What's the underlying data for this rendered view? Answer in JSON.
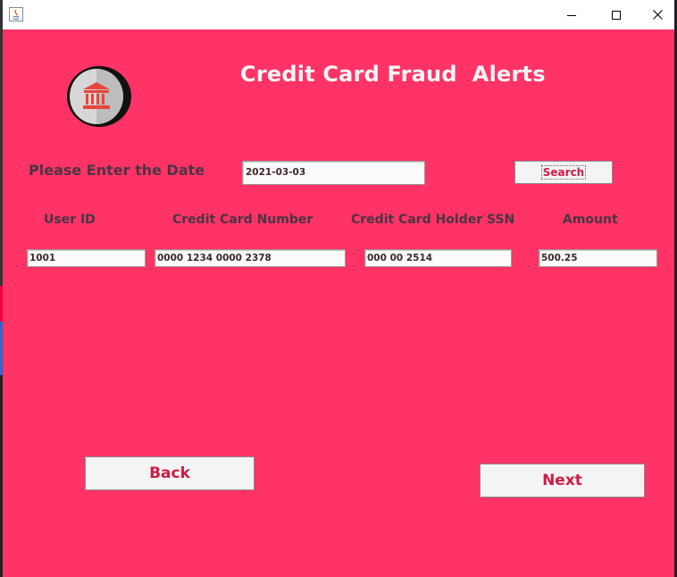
{
  "window": {
    "icon": "java-icon",
    "controls": {
      "minimize": "minimize-icon",
      "maximize": "maximize-icon",
      "close": "close-icon"
    }
  },
  "header": {
    "logo_icon": "bank-icon",
    "title": "Credit Card Fraud  Alerts"
  },
  "search": {
    "date_label": "Please Enter the Date",
    "date_value": "2021-03-03",
    "button_label": "Search"
  },
  "record": {
    "columns": [
      "User ID",
      "Credit Card Number",
      "Credit Card Holder SSN",
      "Amount"
    ],
    "values": [
      "1001",
      "0000 1234 0000 2378",
      "000 00 2514",
      "500.25"
    ]
  },
  "footer": {
    "back_label": "Back",
    "next_label": "Next"
  },
  "colors": {
    "background": "#ff3366",
    "title_text": "#f5f5f5",
    "label_text": "#4a3545",
    "button_text": "#d01a46"
  }
}
